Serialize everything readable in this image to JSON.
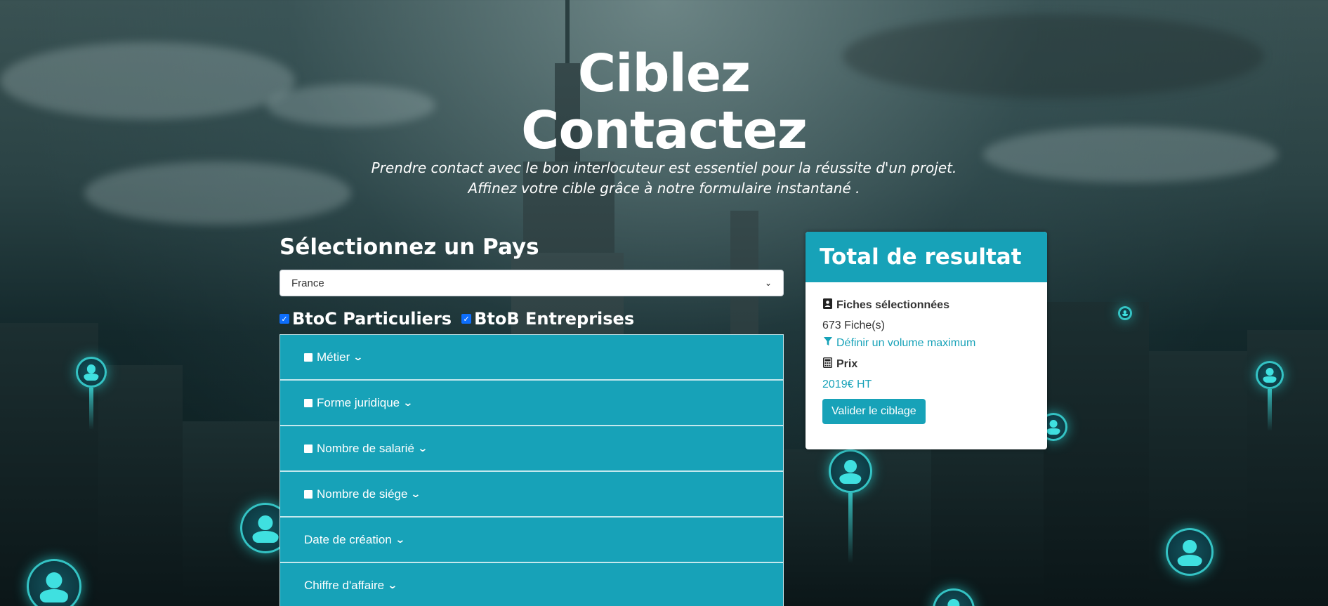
{
  "hero": {
    "title_line1": "Ciblez",
    "title_line2": "Contactez",
    "subtitle_line1": "Prendre contact avec le bon interlocuteur est essentiel pour la réussite d'un projet.",
    "subtitle_line2": "Affinez votre cible grâce à notre formulaire instantané ."
  },
  "form": {
    "country_heading": "Sélectionnez un Pays",
    "country_selected": "France",
    "btoc_label": "BtoC Particuliers",
    "btob_label": "BtoB Entreprises",
    "btoc_checked": true,
    "btob_checked": true,
    "filters": [
      {
        "label": "Métier",
        "has_checkbox": true
      },
      {
        "label": "Forme juridique",
        "has_checkbox": true
      },
      {
        "label": "Nombre de salarié",
        "has_checkbox": true
      },
      {
        "label": "Nombre de siége",
        "has_checkbox": true
      },
      {
        "label": "Date de création",
        "has_checkbox": false
      },
      {
        "label": "Chiffre d'affaire",
        "has_checkbox": false
      }
    ]
  },
  "result": {
    "title": "Total de resultat",
    "selected_label": "Fiches sélectionnées",
    "count_text": "673 Fiche(s)",
    "max_volume_link": "Définir un volume maximum",
    "price_label": "Prix",
    "price_value": "2019€ HT",
    "validate_button": "Valider le ciblage"
  },
  "icons": {
    "contact": "contact-book-icon",
    "filter": "filter-icon",
    "price": "calculator-icon",
    "chevron": "chevron-down-icon"
  },
  "colors": {
    "accent": "#17a2b8",
    "checkbox": "#0d6efd"
  }
}
